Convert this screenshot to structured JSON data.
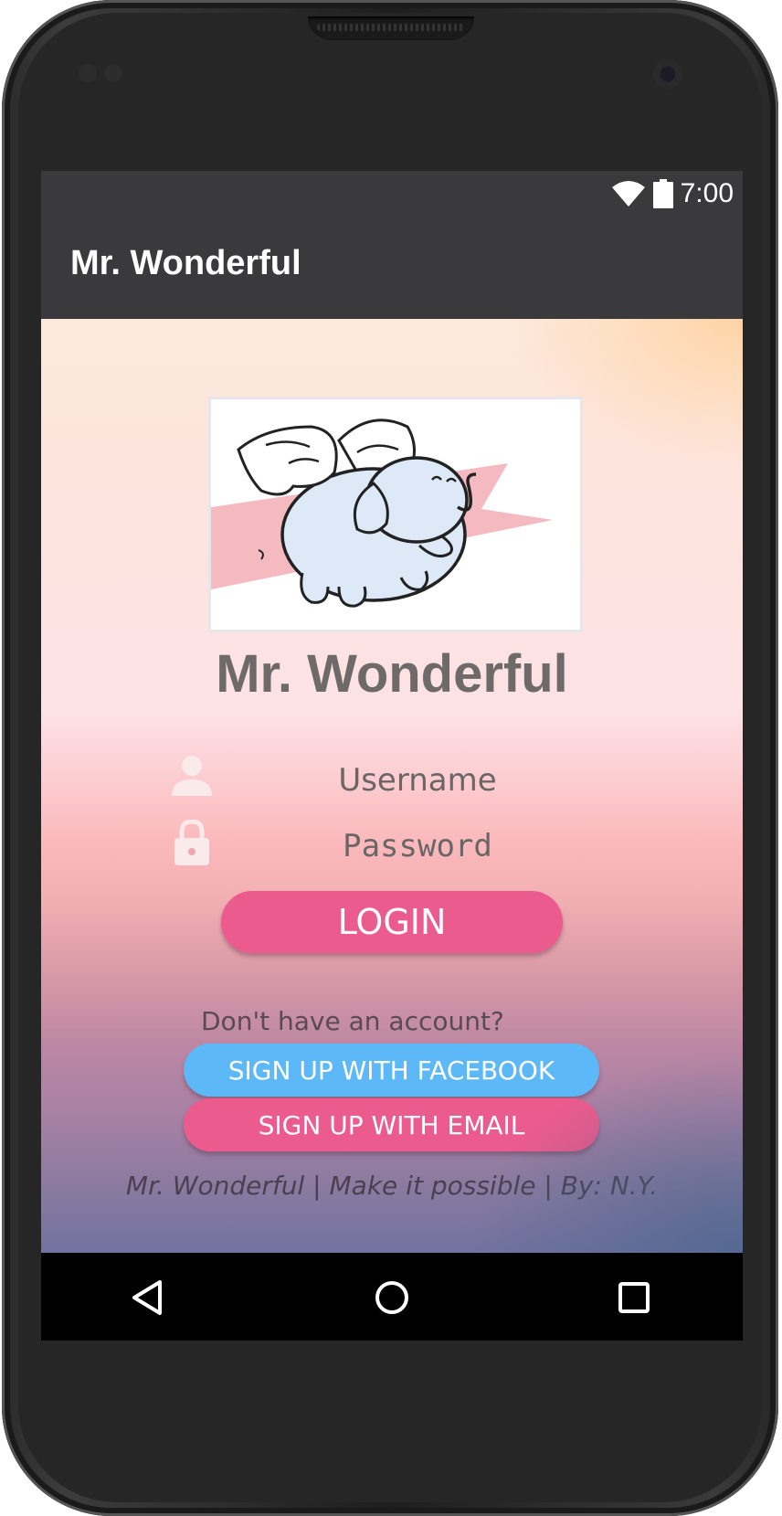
{
  "status_bar": {
    "time": "7:00",
    "icons": [
      "wifi-icon",
      "battery-icon"
    ]
  },
  "app_bar": {
    "title": "Mr. Wonderful"
  },
  "login": {
    "brand_title": "Mr. Wonderful",
    "logo": "flying-elephant-logo",
    "username_placeholder": "Username",
    "password_placeholder": "Password",
    "login_label": "LOGIN",
    "signup_prompt": "Don't have an account?",
    "facebook_label": "SIGN UP WITH FACEBOOK",
    "email_label": "SIGN UP WITH EMAIL",
    "footer": "Mr. Wonderful | Make it possible | By: N.Y."
  },
  "colors": {
    "app_bar": "#3a3a3c",
    "accent_pink": "#ec5b8d",
    "facebook_blue": "#5cb8f6",
    "title_gray": "#6f6a6a"
  },
  "nav": {
    "buttons": [
      "back-icon",
      "home-icon",
      "recents-icon"
    ]
  }
}
